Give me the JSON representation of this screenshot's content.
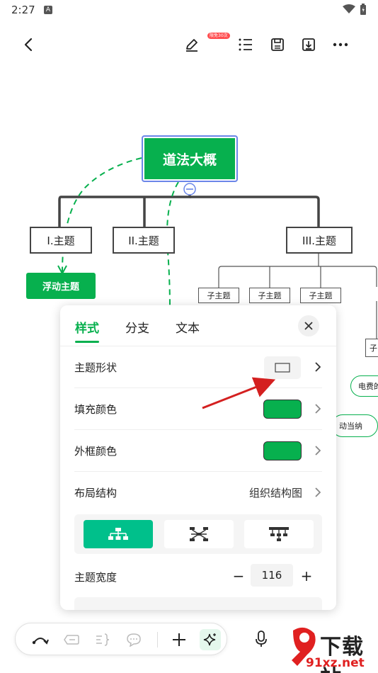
{
  "status_bar": {
    "time": "2:27",
    "notif_letter": "A"
  },
  "toolbar": {
    "badge": "限免30次"
  },
  "mindmap": {
    "root": "道法大概",
    "topics": [
      "I.主题",
      "II.主题",
      "III.主题"
    ],
    "floating_topic": "浮动主题",
    "subtopics": [
      "子主题",
      "子主题",
      "子主题"
    ],
    "right_sub": "子",
    "pill1": "电费的",
    "pill2": "动当纳"
  },
  "panel": {
    "tabs": [
      "样式",
      "分支",
      "文本"
    ],
    "rows": {
      "shape": "主题形状",
      "fill": "填充颜色",
      "border": "外框颜色",
      "layout": "布局结构",
      "layout_value": "组织结构图"
    },
    "width": {
      "label": "主题宽度",
      "minus": "−",
      "value": "116",
      "plus": "+"
    },
    "fill_color": "#07b04e",
    "border_color": "#07b04e",
    "layout_selected_index": 0
  },
  "watermark": {
    "brand": "下载站",
    "url": "91xz.net"
  },
  "colors": {
    "accent": "#07b04e",
    "selected": "#00c08b",
    "annotation_arrow": "#d42020"
  }
}
